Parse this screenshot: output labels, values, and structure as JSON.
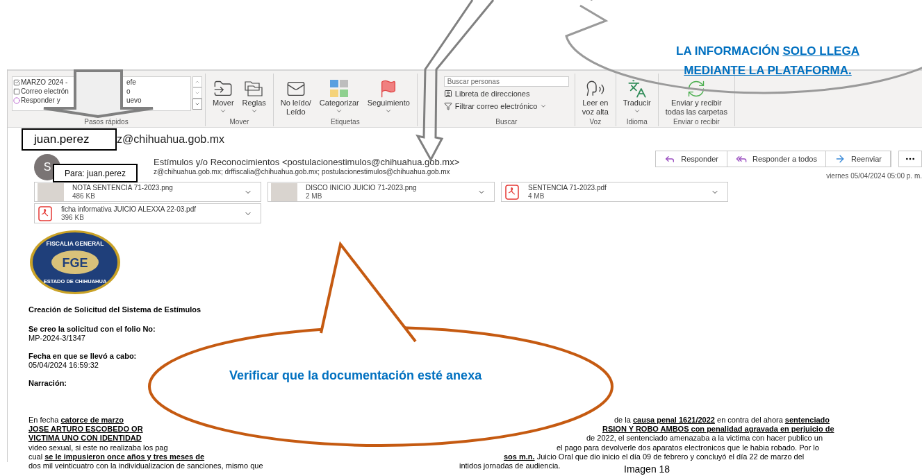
{
  "ribbon": {
    "groups": [
      {
        "kind": "quick_steps",
        "label": "Pasos rápidos",
        "items": [
          {
            "kind": "task",
            "left": "MARZO 2024 -",
            "right": "efe"
          },
          {
            "kind": "mail",
            "left": "Correo electrón",
            "right": "o"
          },
          {
            "kind": "reply",
            "left": "Responder y",
            "right": "uevo"
          }
        ]
      },
      {
        "kind": "buttons",
        "label": "Mover",
        "buttons": [
          {
            "lines": [
              "Mover"
            ],
            "dropdown": true
          },
          {
            "lines": [
              "Reglas"
            ],
            "dropdown": true
          }
        ]
      },
      {
        "kind": "buttons",
        "label": "Etiquetas",
        "buttons": [
          {
            "lines": [
              "No leído/",
              "Leído"
            ],
            "dropdown": false
          },
          {
            "lines": [
              "Categorizar"
            ],
            "dropdown": true
          },
          {
            "lines": [
              "Seguimiento"
            ],
            "dropdown": true
          }
        ]
      },
      {
        "kind": "search",
        "label": "Buscar",
        "placeholder": "Buscar personas",
        "links": [
          {
            "text": "Libreta de direcciones",
            "dropdown": false
          },
          {
            "text": "Filtrar correo electrónico",
            "dropdown": true
          }
        ]
      },
      {
        "kind": "buttons",
        "label": "Voz",
        "buttons": [
          {
            "lines": [
              "Leer en",
              "voz alta"
            ],
            "dropdown": false
          }
        ]
      },
      {
        "kind": "buttons",
        "label": "Idioma",
        "buttons": [
          {
            "lines": [
              "Traducir"
            ],
            "dropdown": true
          }
        ]
      },
      {
        "kind": "buttons",
        "label": "Enviar o recibir",
        "buttons": [
          {
            "lines": [
              "Enviar y recibir",
              "todas las carpetas"
            ],
            "dropdown": false
          }
        ]
      }
    ]
  },
  "email": {
    "address_box": "juan.perez",
    "address_rest": "z@chihuahua.gob.mx",
    "avatar": "S",
    "para_box": "Para: juan.perez",
    "sender": "Estímulos y/o Reconocimientos <postulacionestimulos@chihuahua.gob.mx>",
    "recipients": "z@chihuahua.gob.mx; drffiscalia@chihuahua.gob.mx; postulacionestimulos@chihuahua.gob.mx",
    "actions": [
      "Responder",
      "Responder a todos",
      "Reenviar"
    ],
    "date": "viernes 05/04/2024 05:00 p. m.",
    "attachments": [
      {
        "kind": "image",
        "name": "NOTA SENTENCIA 71-2023.png",
        "size": "486 KB"
      },
      {
        "kind": "image",
        "name": "DISCO INICIO JUICIO 71-2023.png",
        "size": "2 MB"
      },
      {
        "kind": "pdf",
        "name": "SENTENCIA 71-2023.pdf",
        "size": "4 MB"
      },
      {
        "kind": "pdf",
        "name": "ficha informativa JUICIO ALEXXA 22-03.pdf",
        "size": "396 KB"
      }
    ]
  },
  "body": {
    "logo": {
      "top": "FISCALIA GENERAL",
      "center": "FGE",
      "bottom": "ESTADO DE CHIHUAHUA"
    },
    "title": "Creación de Solicitud del Sistema de Estímulos",
    "fields": [
      {
        "label": "Se creo la solicitud con el folio No:",
        "value": "MP-2024-3/1347"
      },
      {
        "label": "Fecha en que se llevó a cabo:",
        "value": "05/04/2024 16:59:32"
      },
      {
        "label": "Narración:"
      }
    ],
    "narrative": [
      {
        "left": [
          {
            "text": "En fecha ",
            "strong": false
          },
          {
            "text": "catorce de marzo",
            "strong": true
          }
        ],
        "right": [
          {
            "text": "de la ",
            "strong": false
          },
          {
            "text": "causa penal 1621/2022",
            "strong": true
          },
          {
            "text": " en contra del ahora ",
            "strong": false
          },
          {
            "text": "sentenciado",
            "strong": true
          }
        ]
      },
      {
        "left": [
          {
            "text": "JOSE ARTURO ESCOBEDO OR",
            "strong": true
          }
        ],
        "right": [
          {
            "text": "RSION Y ROBO AMBOS con penalidad agravada en perjuicio de",
            "strong": true
          }
        ]
      },
      {
        "left": [
          {
            "text": "VICTIMA UNO CON IDENTIDAD",
            "strong": true
          }
        ],
        "right": [
          {
            "text": "de 2022, el sentenciado amenazaba a la victima con hacer publico un",
            "strong": false
          }
        ]
      },
      {
        "left": [
          {
            "text": "video sexual, si este no realizaba los pag",
            "strong": false
          }
        ],
        "right": [
          {
            "text": "el pago para devolverle dos aparatos electronicos que le habia robado. Por lo",
            "strong": false
          }
        ]
      },
      {
        "left": [
          {
            "text": "cual ",
            "strong": false
          },
          {
            "text": "se le impusieron once años y tres meses de",
            "strong": true
          }
        ],
        "right": [
          {
            "text": "sos m.n.",
            "strong": true
          },
          {
            "text": "  Juicio Oral que dio inicio el día 09 de febrero  y concluyó el día 22 de marzo del",
            "strong": false
          }
        ]
      },
      {
        "left": [
          {
            "text": "dos mil veinticuatro con la individualizacion de sanciones, mismo que",
            "strong": false
          }
        ],
        "right": [
          {
            "text": "intidos jornadas de audiencia.",
            "strong": false
          }
        ]
      }
    ]
  },
  "callouts": [
    {
      "kind": "cloud",
      "text": "LA INFORMACIÓN ",
      "underlined": "SOLO LLEGA MEDIANTE LA PLATAFORMA."
    },
    {
      "kind": "oval",
      "text": "Verificar que la documentación esté anexa"
    }
  ],
  "caption": "Imagen 18"
}
